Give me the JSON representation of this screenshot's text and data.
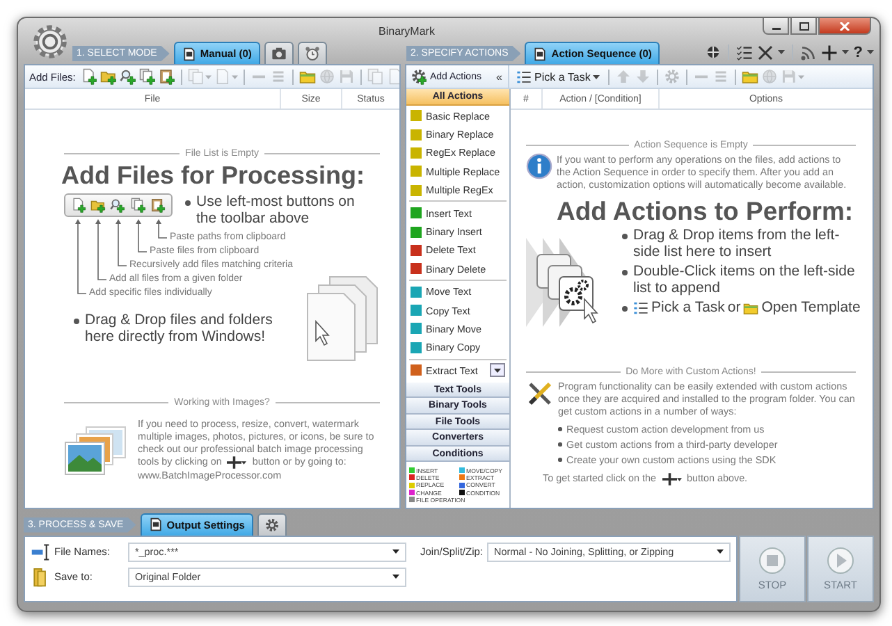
{
  "window": {
    "title": "BinaryMark"
  },
  "mode": {
    "step": "1. SELECT MODE",
    "tabs": [
      {
        "kind": "text",
        "label": "Manual (0)",
        "selected": true
      },
      {
        "kind": "camera",
        "selected": false
      },
      {
        "kind": "alarm",
        "selected": false
      }
    ]
  },
  "actions_step": {
    "step": "2. SPECIFY ACTIONS",
    "tabs": [
      {
        "kind": "text",
        "label": "Action Sequence (0)",
        "selected": true
      }
    ],
    "help_label": "?"
  },
  "files_toolbar": {
    "label": "Add Files:",
    "tool_groups": [
      [
        {
          "kind": "file-plus",
          "disabled": false,
          "dropdown": false
        },
        {
          "kind": "folder-plus",
          "disabled": false,
          "dropdown": false
        },
        {
          "kind": "magnifier-plus",
          "disabled": false,
          "dropdown": false
        },
        {
          "kind": "pages-plus",
          "disabled": false,
          "dropdown": false
        },
        {
          "kind": "clipboard-plus",
          "disabled": false,
          "dropdown": false
        }
      ],
      [
        {
          "kind": "copy",
          "disabled": true,
          "dropdown": true
        },
        {
          "kind": "page",
          "disabled": true,
          "dropdown": true
        }
      ],
      [
        {
          "kind": "minus",
          "disabled": true,
          "dropdown": false
        },
        {
          "kind": "list",
          "disabled": true,
          "dropdown": false
        }
      ],
      [
        {
          "kind": "folder",
          "disabled": false,
          "dropdown": false
        },
        {
          "kind": "globe",
          "disabled": true,
          "dropdown": false
        },
        {
          "kind": "floppy",
          "disabled": true,
          "dropdown": false
        }
      ],
      [
        {
          "kind": "copy",
          "disabled": true,
          "dropdown": false
        },
        {
          "kind": "page",
          "disabled": true,
          "dropdown": false
        }
      ]
    ]
  },
  "file_table": {
    "columns": [
      "File",
      "Size",
      "Status"
    ]
  },
  "file_empty": {
    "caption": "File List is Empty",
    "heading": "Add Files for Processing:",
    "bullets": [
      "Use left-most buttons on the toolbar above",
      "Drag & Drop files and folders here directly from Windows!"
    ],
    "callouts": [
      "Paste paths from clipboard",
      "Paste files from clipboard",
      "Recursively add files matching criteria",
      "Add all files from a given folder",
      "Add specific files individually"
    ],
    "images_caption": "Working with Images?",
    "images_text_before": "If you need to process, resize, convert, watermark multiple images, photos, pictures, or icons, be sure to check out our professional batch image processing tools by clicking on",
    "images_text_after": "button or by going to: www.BatchImageProcessor.com"
  },
  "actions_toolbar": {
    "label": "Add Actions",
    "collapse": "«"
  },
  "sequence_toolbar": {
    "pick": "Pick a Task",
    "tool_groups": [
      [
        {
          "kind": "arrow-up",
          "disabled": true,
          "dropdown": false
        },
        {
          "kind": "arrow-down",
          "disabled": true,
          "dropdown": false
        }
      ],
      [
        {
          "kind": "gear",
          "disabled": true,
          "dropdown": false
        }
      ],
      [
        {
          "kind": "minus",
          "disabled": true,
          "dropdown": false
        },
        {
          "kind": "list",
          "disabled": true,
          "dropdown": false
        }
      ],
      [
        {
          "kind": "folder",
          "disabled": false,
          "dropdown": false
        },
        {
          "kind": "globe",
          "disabled": true,
          "dropdown": false
        },
        {
          "kind": "floppy",
          "disabled": true,
          "dropdown": true
        }
      ]
    ]
  },
  "sequence_table": {
    "columns": [
      "#",
      "Action / [Condition]",
      "Options"
    ]
  },
  "action_categories": [
    {
      "label": "All Actions",
      "expanded": true,
      "groups": [
        [
          {
            "label": "Basic Replace",
            "color": "#c9b400"
          },
          {
            "label": "Binary Replace",
            "color": "#c9b400"
          },
          {
            "label": "RegEx Replace",
            "color": "#c9b400"
          },
          {
            "label": "Multiple Replace",
            "color": "#c9b400"
          },
          {
            "label": "Multiple RegEx",
            "color": "#c9b400"
          }
        ],
        [
          {
            "label": "Insert Text",
            "color": "#1fa51f"
          },
          {
            "label": "Binary Insert",
            "color": "#1fa51f"
          },
          {
            "label": "Delete Text",
            "color": "#c8301c"
          },
          {
            "label": "Binary Delete",
            "color": "#c8301c"
          }
        ],
        [
          {
            "label": "Move Text",
            "color": "#1aa6b4"
          },
          {
            "label": "Copy Text",
            "color": "#1aa6b4"
          },
          {
            "label": "Binary Move",
            "color": "#1aa6b4"
          },
          {
            "label": "Binary Copy",
            "color": "#1aa6b4"
          }
        ],
        [
          {
            "label": "Extract Text",
            "color": "#d0601c"
          }
        ]
      ]
    },
    {
      "label": "Text Tools",
      "expanded": false
    },
    {
      "label": "Binary Tools",
      "expanded": false
    },
    {
      "label": "File Tools",
      "expanded": false
    },
    {
      "label": "Converters",
      "expanded": false
    },
    {
      "label": "Conditions",
      "expanded": false
    }
  ],
  "legend": [
    {
      "label": "INSERT",
      "color": "#33cc33"
    },
    {
      "label": "MOVE/COPY",
      "color": "#33bbdd"
    },
    {
      "label": "DELETE",
      "color": "#dd2222"
    },
    {
      "label": "EXTRACT",
      "color": "#ee7711"
    },
    {
      "label": "REPLACE",
      "color": "#ddcc00"
    },
    {
      "label": "CONVERT",
      "color": "#3366dd"
    },
    {
      "label": "CHANGE",
      "color": "#dd22cc"
    },
    {
      "label": "CONDITION",
      "color": "#111111"
    },
    {
      "label": "FILE OPERATION",
      "color": "#888888"
    }
  ],
  "sequence_empty": {
    "caption": "Action Sequence is Empty",
    "info": "If you want to perform any operations on the files, add actions to the Action Sequence in order to specify them. After you add an action, customization options will automatically become available.",
    "heading": "Add Actions to Perform:",
    "bullets": [
      "Drag & Drop items from the left-side list here to insert",
      "Double-Click items on the left-side list to append"
    ],
    "pick_task": "Pick a Task",
    "or": "or",
    "open_template": "Open Template",
    "custom_caption": "Do More with Custom Actions!",
    "custom_text": "Program functionality can be easily extended with custom actions once they are acquired and installed to the program folder. You can get custom actions in a number of ways:",
    "custom_ways": [
      "Request custom action development from us",
      "Get custom actions from a third-party developer",
      "Create your own custom actions using the SDK"
    ],
    "start_before": "To get started click on the",
    "start_after": "button above."
  },
  "output": {
    "step": "3. PROCESS & SAVE",
    "tabs": [
      {
        "kind": "text",
        "label": "Output Settings",
        "selected": true
      },
      {
        "kind": "gear",
        "selected": false
      }
    ],
    "fields": [
      {
        "kind": "names",
        "label": "File Names:",
        "value": "*_proc.***"
      },
      {
        "kind": "folder",
        "label": "Save to:",
        "value": "Original Folder"
      }
    ],
    "join": {
      "label": "Join/Split/Zip:",
      "value": "Normal - No Joining, Splitting, or Zipping"
    },
    "buttons": [
      {
        "kind": "stop",
        "label": "STOP",
        "disabled": true
      },
      {
        "kind": "start",
        "label": "START",
        "disabled": true
      }
    ]
  }
}
